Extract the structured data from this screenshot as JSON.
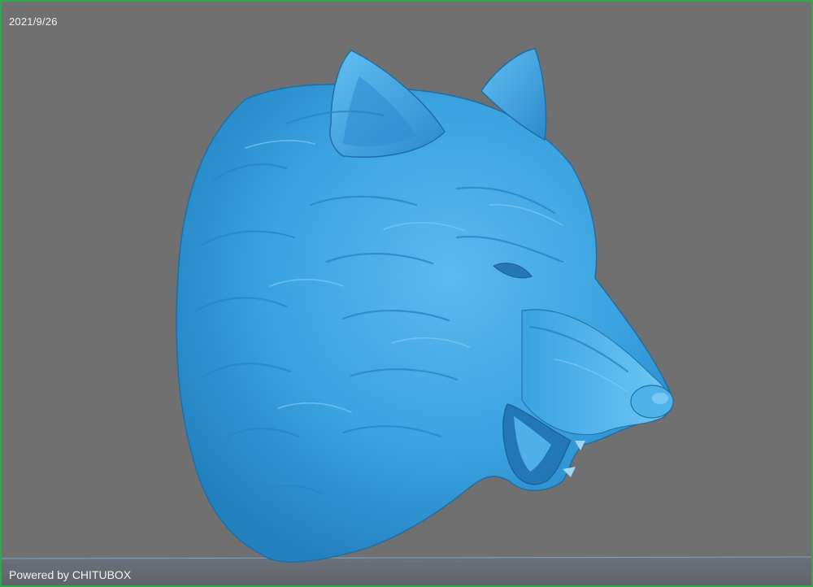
{
  "viewport": {
    "date": "2021/9/26",
    "powered_by": "Powered by CHITUBOX"
  },
  "model": {
    "icon": "wolf-head-model",
    "color": "#3aa3e0",
    "shadow_color": "#1f6fa6",
    "highlight_color": "#8fd0f6"
  },
  "colors": {
    "background": "#707070",
    "frame_border": "#2ea84a",
    "plate": "#5d6670"
  }
}
